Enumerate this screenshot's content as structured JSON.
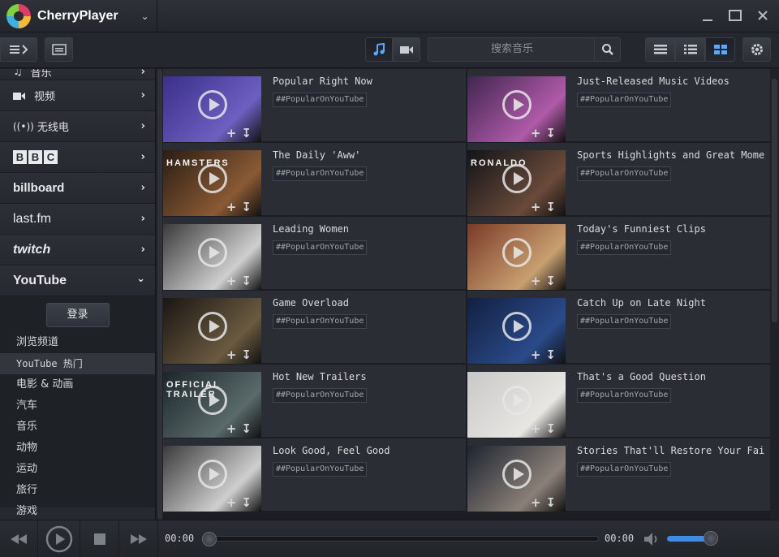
{
  "app": {
    "title": "CherryPlayer"
  },
  "toolbar": {
    "search_placeholder": "搜索音乐"
  },
  "sidebar": {
    "items": [
      {
        "label": "音乐",
        "icon": "music-note-icon"
      },
      {
        "label": "视频",
        "icon": "video-camera-icon"
      },
      {
        "label": "无线电",
        "icon": "radio-icon"
      },
      {
        "label": "BBC",
        "icon": "bbc-logo"
      },
      {
        "label": "billboard",
        "icon": "billboard-logo"
      },
      {
        "label": "last.fm",
        "icon": "lastfm-logo"
      },
      {
        "label": "twitch",
        "icon": "twitch-logo"
      },
      {
        "label": "YouTube",
        "icon": "youtube-logo"
      }
    ],
    "youtube": {
      "login_label": "登录",
      "links": [
        "浏览频道",
        "YouTube 热门",
        "电影 & 动画",
        "汽车",
        "音乐",
        "动物",
        "运动",
        "旅行",
        "游戏"
      ],
      "active_index": 1
    }
  },
  "grid": {
    "cards": [
      {
        "title": "Popular Right Now",
        "tag": "##PopularOnYouTube",
        "caption": "",
        "colors": [
          "#3a2f8a",
          "#6d5fc0"
        ]
      },
      {
        "title": "Just-Released Music Videos",
        "tag": "##PopularOnYouTube",
        "caption": "",
        "colors": [
          "#402650",
          "#b05aa8"
        ]
      },
      {
        "title": "The Daily 'Aww'",
        "tag": "##PopularOnYouTube",
        "caption": "HAMSTERS",
        "colors": [
          "#2a1d14",
          "#8a5a34"
        ]
      },
      {
        "title": "Sports Highlights and Great Moments",
        "tag": "##PopularOnYouTube",
        "caption": "RONALDO",
        "colors": [
          "#121418",
          "#6a4a3a"
        ]
      },
      {
        "title": "Leading Women",
        "tag": "##PopularOnYouTube",
        "caption": "",
        "colors": [
          "#3a3a3a",
          "#cfcfcf"
        ]
      },
      {
        "title": "Today's Funniest Clips",
        "tag": "##PopularOnYouTube",
        "caption": "",
        "colors": [
          "#7a3a28",
          "#c8a070"
        ]
      },
      {
        "title": "Game Overload",
        "tag": "##PopularOnYouTube",
        "caption": "",
        "colors": [
          "#1a1612",
          "#6a5a40"
        ]
      },
      {
        "title": "Catch Up on Late Night",
        "tag": "##PopularOnYouTube",
        "caption": "",
        "colors": [
          "#122040",
          "#2a4a8a"
        ]
      },
      {
        "title": "Hot New Trailers",
        "tag": "##PopularOnYouTube",
        "caption": "OFFICIAL TRAILER",
        "colors": [
          "#1c262a",
          "#5a6a6a"
        ]
      },
      {
        "title": "That's a Good Question",
        "tag": "##PopularOnYouTube",
        "caption": "",
        "colors": [
          "#c8c8c8",
          "#e8e6e2"
        ]
      },
      {
        "title": "Look Good, Feel Good",
        "tag": "##PopularOnYouTube",
        "caption": "",
        "colors": [
          "#3a3a3a",
          "#cfcfcf"
        ]
      },
      {
        "title": "Stories That'll Restore Your Faith",
        "tag": "##PopularOnYouTube",
        "caption": "",
        "colors": [
          "#1e2430",
          "#8a8078"
        ]
      }
    ]
  },
  "player": {
    "elapsed": "00:00",
    "total": "00:00",
    "progress": 0,
    "volume": 0.9
  }
}
